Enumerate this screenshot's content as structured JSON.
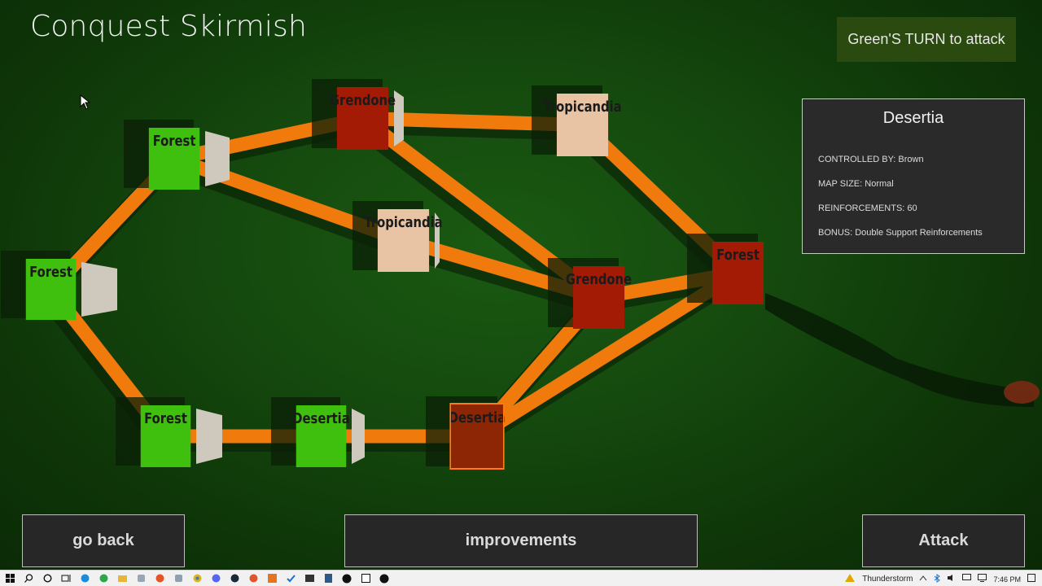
{
  "game_title": "Conquest Skirmish",
  "turn_banner": "Green'S TURN to attack",
  "territories": [
    {
      "id": "t1",
      "name": "Forest",
      "owner": "green"
    },
    {
      "id": "t2",
      "name": "Grendone",
      "owner": "red"
    },
    {
      "id": "t3",
      "name": "Tropicandia",
      "owner": "peach"
    },
    {
      "id": "t4",
      "name": "Tropicandia",
      "owner": "peach"
    },
    {
      "id": "t5",
      "name": "Forest",
      "owner": "green"
    },
    {
      "id": "t6",
      "name": "Grendone",
      "owner": "red"
    },
    {
      "id": "t7",
      "name": "Forest",
      "owner": "red"
    },
    {
      "id": "t8",
      "name": "Forest",
      "owner": "green"
    },
    {
      "id": "t9",
      "name": "Desertia",
      "owner": "green"
    },
    {
      "id": "t10",
      "name": "Desertia",
      "owner": "brown",
      "selected": true
    }
  ],
  "connections": [
    [
      "t1",
      "t2"
    ],
    [
      "t1",
      "t4"
    ],
    [
      "t1",
      "t5"
    ],
    [
      "t2",
      "t3"
    ],
    [
      "t2",
      "t6"
    ],
    [
      "t3",
      "t7"
    ],
    [
      "t4",
      "t6"
    ],
    [
      "t6",
      "t7"
    ],
    [
      "t5",
      "t8"
    ],
    [
      "t8",
      "t9"
    ],
    [
      "t9",
      "t10"
    ],
    [
      "t10",
      "t6"
    ],
    [
      "t10",
      "t7"
    ]
  ],
  "colors": {
    "green": "#3fbf0e",
    "red": "#a31a05",
    "peach": "#e8c3a4",
    "brown": "#8c2605",
    "road": "#f07a0c",
    "selected_border": "#ff7a18"
  },
  "info_panel": {
    "name": "Desertia",
    "controlled_by": "CONTROLLED BY: Brown",
    "map_size": "MAP SIZE: Normal",
    "reinforcements": "REINFORCEMENTS: 60",
    "bonus": "BONUS: Double Support Reinforcements"
  },
  "buttons": {
    "go_back": "go back",
    "improvements": "improvements",
    "attack": "Attack"
  },
  "taskbar": {
    "weather": "Thunderstorm",
    "time": "7:46 PM"
  }
}
